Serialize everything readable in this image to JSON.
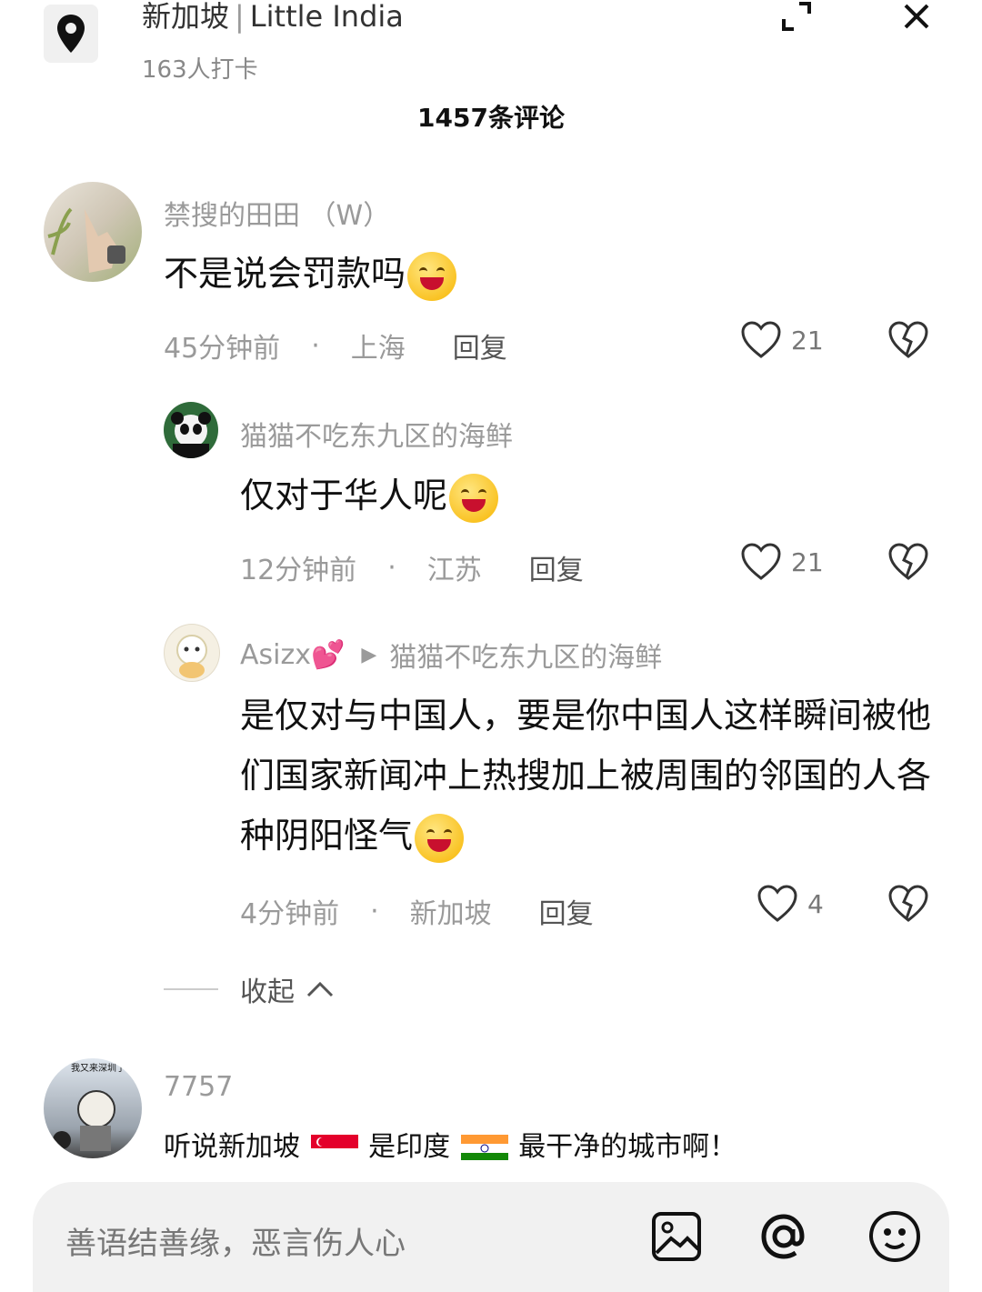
{
  "header": {
    "location": "新加坡",
    "place": "Little India",
    "checkins": "163人打卡",
    "comment_count": "1457条评论",
    "icons": [
      "location-pin-icon",
      "collapse-icon",
      "close-icon"
    ]
  },
  "comments": [
    {
      "user": "禁搜的田田 （W）",
      "text": "不是说会罚款吗",
      "emoji": "grinning-squint-emoji",
      "time": "45分钟前",
      "dot": "·",
      "location": "上海",
      "reply": "回复",
      "likes": "21"
    },
    {
      "user": "猫猫不吃东九区的海鲜",
      "text": "仅对于华人呢",
      "emoji": "crying-laughing-emoji",
      "time": "12分钟前",
      "dot": "·",
      "location": "江苏",
      "reply": "回复",
      "likes": "21"
    },
    {
      "user": "Asizx💕",
      "reply_to": "猫猫不吃东九区的海鲜",
      "text": "是仅对与中国人，要是你中国人这样瞬间被他们国家新闻冲上热搜加上被周围的邻国的人各种阴阳怪气",
      "emoji": "grinning-emoji",
      "time": "4分钟前",
      "dot": "·",
      "location": "新加坡",
      "reply": "回复",
      "likes": "4"
    },
    {
      "user": "7757",
      "avatar_caption": "我又来深圳了",
      "text_a": "听说新加坡",
      "text_b": "是印度",
      "text_c": "最干净的城市啊！"
    }
  ],
  "collapse_label": "收起",
  "input": {
    "placeholder": "善语结善缘，恶言伤人心",
    "icons": [
      "image-icon",
      "at-icon",
      "emoji-icon"
    ]
  },
  "colors": {
    "accent": "#111111",
    "muted": "#9a9a9a",
    "input_bg": "#f1f1f1"
  }
}
